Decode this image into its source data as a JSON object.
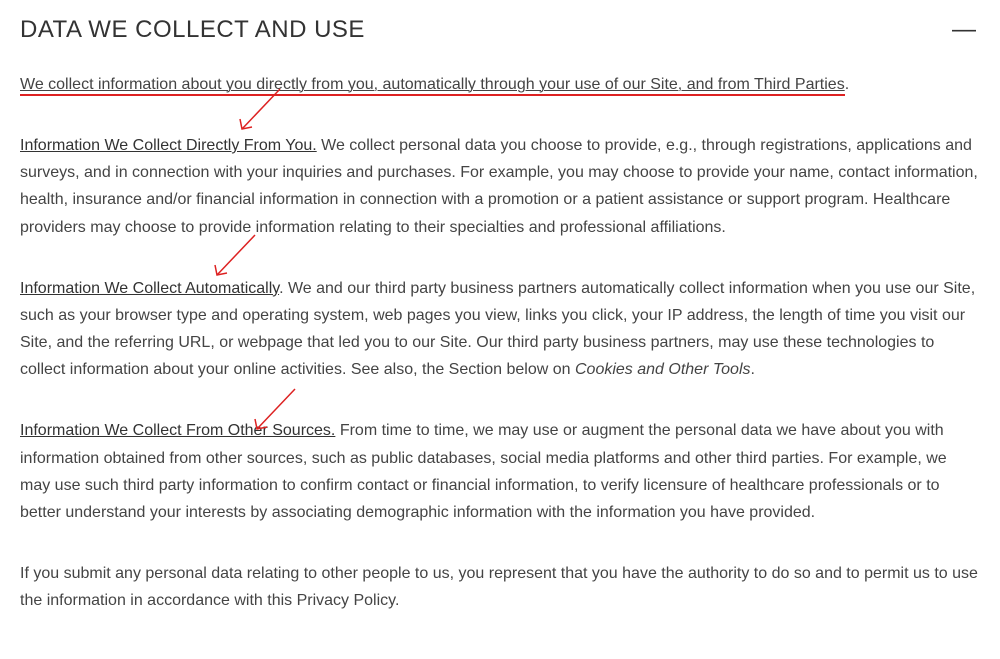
{
  "title": "DATA WE COLLECT AND USE",
  "collapse_symbol": "—",
  "intro_underlined": "We collect information about you directly from you, automatically through your use of our Site, and from Third Parties",
  "intro_period": ".",
  "sec1_heading": "Information We Collect Directly From You.",
  "sec1_body": " We collect personal data you choose to provide, e.g., through registrations, applications and surveys, and in connection with your inquiries and purchases. For example, you may choose to provide your name, contact information, health, insurance and/or financial information in connection with a promotion or a patient assistance or support program. Healthcare providers may choose to provide information relating to their specialties and professional affiliations.",
  "sec2_heading": "Information We Collect Automatically",
  "sec2_body_a": ". We and our third party business partners automatically collect information when you use our Site, such as your browser type and operating system, web pages you view, links you click, your IP address, the length of time you visit our Site, and the referring URL, or webpage that led you to our Site. Our third party business partners, may use these technologies to collect information about your online activities. See also, the Section below on ",
  "sec2_italic": "Cookies and Other Tools",
  "sec2_body_b": ".",
  "sec3_heading": "Information We Collect From Other Sources.",
  "sec3_body": " From time to time, we may use or augment the personal data we have about you with information obtained from other sources, such as public databases, social media platforms and other third parties. For example, we may use such third party information to confirm contact or financial information, to verify licensure of healthcare professionals or to better understand your interests by associating demographic information with the information you have provided.",
  "sec4_body": "If you submit any personal data relating to other people to us, you represent that you have the authority to do so and to permit us to use the information in accordance with this Privacy Policy."
}
